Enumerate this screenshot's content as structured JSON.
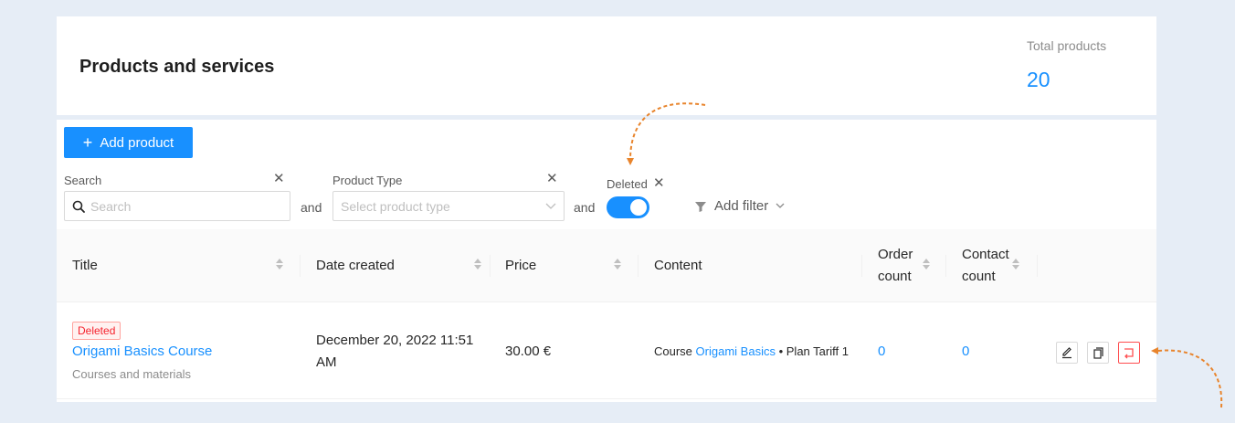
{
  "header": {
    "title": "Products and services",
    "stat_label": "Total products",
    "stat_value": "20"
  },
  "toolbar": {
    "add_label": "Add product"
  },
  "filters": {
    "search": {
      "label": "Search",
      "placeholder": "Search"
    },
    "product_type": {
      "label": "Product Type",
      "placeholder": "Select product type"
    },
    "and_label": "and",
    "deleted": {
      "label": "Deleted",
      "value": true
    },
    "add_filter_label": "Add filter"
  },
  "table": {
    "columns": [
      "Title",
      "Date created",
      "Price",
      "Content",
      "Order count",
      "Contact count"
    ],
    "rows": [
      {
        "badge": "Deleted",
        "title": "Origami Basics Course",
        "subtitle": "Courses and materials",
        "date": "December 20, 2022 11:51 AM",
        "price": "30.00 €",
        "content_prefix": "Course",
        "content_link": "Origami Basics",
        "content_suffix": "• Plan Tariff 1",
        "order_count": "0",
        "contact_count": "0"
      }
    ]
  },
  "colors": {
    "primary": "#1890ff",
    "danger": "#ff4d4f",
    "annotation": "#e8842c"
  },
  "icons": [
    "plus-icon",
    "close-icon",
    "search-icon",
    "chevron-down-icon",
    "funnel-icon",
    "sort-icon",
    "edit-icon",
    "copy-icon",
    "restore-icon"
  ]
}
